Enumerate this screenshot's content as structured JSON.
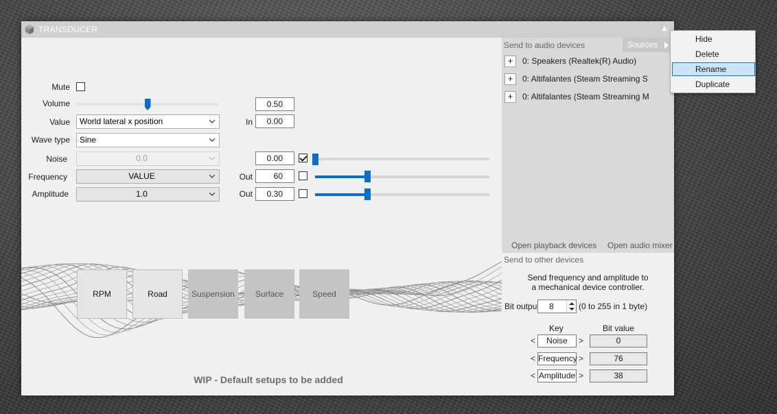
{
  "window": {
    "title": "TRANSDUCER"
  },
  "controls": {
    "mute_label": "Mute",
    "mute_checked": false,
    "volume_label": "Volume",
    "volume_value": "0.50",
    "volume_level": 0.5,
    "value_label": "Value",
    "value_selected": "World lateral x position",
    "in_label": "In",
    "in_value": "0.00",
    "wavetype_label": "Wave type",
    "wavetype_selected": "Sine",
    "noise_label": "Noise",
    "noise_selected": "0.0",
    "noise_value": "0.00",
    "noise_checked": true,
    "noise_level": 0.0,
    "frequency_label": "Frequency",
    "frequency_selected": "VALUE",
    "frequency_out_label": "Out",
    "frequency_out_value": "60",
    "frequency_checked": false,
    "frequency_level": 0.3,
    "amplitude_label": "Amplitude",
    "amplitude_selected": "1.0",
    "amplitude_out_label": "Out",
    "amplitude_out_value": "0.30",
    "amplitude_checked": false,
    "amplitude_level": 0.3
  },
  "presets": {
    "rpm": "RPM",
    "road": "Road",
    "suspension": "Suspension",
    "surface": "Surface",
    "speed": "Speed"
  },
  "wip_text": "WIP - Default setups to be added",
  "audio": {
    "header": "Send to audio devices",
    "sources_label": "Sources",
    "devices": [
      "0: Speakers (Realtek(R) Audio)",
      "0: Altifalantes (Steam Streaming S",
      "0: Altifalantes (Steam Streaming M"
    ],
    "plus": "+",
    "open_playback": "Open playback devices",
    "open_mixer": "Open audio mixer"
  },
  "other": {
    "header": "Send to other devices",
    "desc_line1": "Send frequency and amplitude to",
    "desc_line2": "a mechanical device controller.",
    "bit_output_label": "Bit output",
    "bit_output_value": "8",
    "range_note": "(0 to 255 in 1 byte)",
    "key_header": "Key",
    "bitvalue_header": "Bit value",
    "left_arrow": "<",
    "right_arrow": ">",
    "rows": [
      {
        "key": "Noise",
        "value": "0"
      },
      {
        "key": "Frequency",
        "value": "76"
      },
      {
        "key": "Amplitude",
        "value": "38"
      }
    ]
  },
  "context_menu": {
    "items": [
      "Hide",
      "Delete",
      "Rename",
      "Duplicate"
    ],
    "highlighted": "Rename"
  },
  "icons": {
    "app": "cube-icon",
    "collapse": "triangle-up-icon",
    "dropdown": "chevron-down-icon"
  },
  "colors": {
    "accent": "#0a6fc9",
    "titlebar": "#cfcfcf",
    "menu_highlight": "#cce4f7"
  }
}
